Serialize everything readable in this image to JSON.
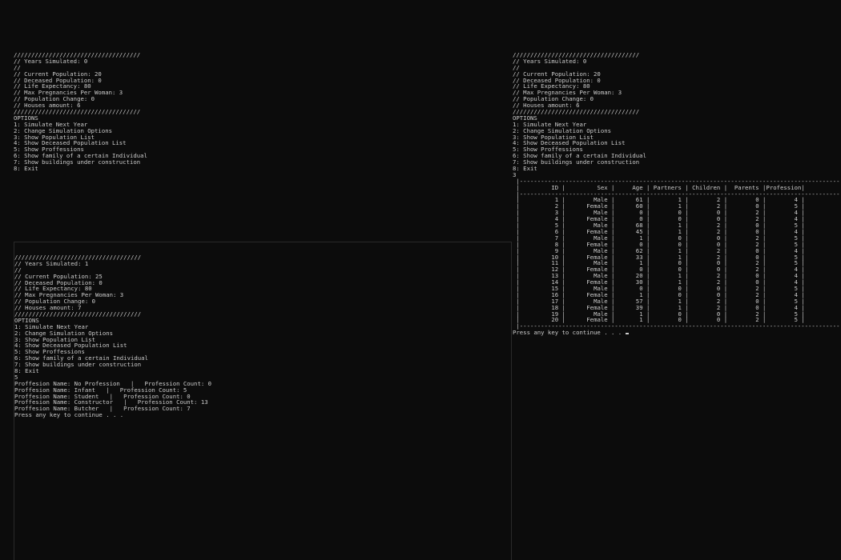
{
  "consoles": [
    {
      "id": "console-1",
      "lines": [
        "////////////////////////////////////",
        "// Years Simulated: 0",
        "//",
        "// Current Population: 20",
        "// Deceased Population: 0",
        "// Life Expectancy: 80",
        "// Max Pregnancies Per Woman: 3",
        "// Population Change: 0",
        "// Houses amount: 6",
        "////////////////////////////////////",
        "OPTIONS",
        "1: Simulate Next Year",
        "2: Change Simulation Options",
        "3: Show Population List",
        "4: Show Deceased Population List",
        "5: Show Proffessions",
        "6: Show family of a certain Individual",
        "7: Show buildings under construction",
        "8: Exit"
      ]
    },
    {
      "id": "console-2",
      "lines": [
        "////////////////////////////////////",
        "// Years Simulated: 1",
        "//",
        "// Current Population: 25",
        "// Deceased Population: 0",
        "// Life Expectancy: 80",
        "// Max Pregnancies Per Woman: 3",
        "// Population Change: 0",
        "// Houses amount: 7",
        "////////////////////////////////////",
        "OPTIONS",
        "1: Simulate Next Year",
        "2: Change Simulation Options",
        "3: Show Population List",
        "4: Show Deceased Population List",
        "5: Show Proffessions",
        "6: Show family of a certain Individual",
        "7: Show buildings under construction",
        "8: Exit",
        "5",
        "Proffesion Name: No Profession   |   Profession Count: 0",
        "Proffesion Name: Infant   |   Profession Count: 5",
        "Proffesion Name: Student   |   Profession Count: 0",
        "Proffesion Name: Constructor   |   Profession Count: 13",
        "Proffesion Name: Butcher   |   Profession Count: 7",
        "Press any key to continue . . ."
      ]
    },
    {
      "id": "console-3",
      "lines": [
        "////////////////////////////////////",
        "// Years Simulated: 0",
        "//",
        "// Current Population: 20",
        "// Deceased Population: 0",
        "// Life Expectancy: 80",
        "// Max Pregnancies Per Woman: 3",
        "// Population Change: 0",
        "// Houses amount: 6",
        "////////////////////////////////////",
        "OPTIONS",
        "1: Simulate Next Year",
        "2: Change Simulation Options",
        "3: Show Population List",
        "4: Show Deceased Population List",
        "5: Show Proffessions",
        "6: Show family of a certain Individual",
        "7: Show buildings under construction",
        "8: Exit",
        "3"
      ],
      "table": {
        "border": " |-------------------------------------------------------------------------------------------|",
        "headers": [
          "ID",
          "Sex",
          "Age",
          "Partners",
          "Children",
          "Parents",
          "Profession"
        ],
        "rows": [
          [
            "1",
            "Male",
            "61",
            "1",
            "2",
            "0",
            "4"
          ],
          [
            "2",
            "Female",
            "60",
            "1",
            "2",
            "0",
            "5"
          ],
          [
            "3",
            "Male",
            "0",
            "0",
            "0",
            "2",
            "4"
          ],
          [
            "4",
            "Female",
            "0",
            "0",
            "0",
            "2",
            "4"
          ],
          [
            "5",
            "Male",
            "68",
            "1",
            "2",
            "0",
            "5"
          ],
          [
            "6",
            "Female",
            "45",
            "1",
            "2",
            "0",
            "4"
          ],
          [
            "7",
            "Male",
            "1",
            "0",
            "0",
            "2",
            "5"
          ],
          [
            "8",
            "Female",
            "0",
            "0",
            "0",
            "2",
            "5"
          ],
          [
            "9",
            "Male",
            "62",
            "1",
            "2",
            "0",
            "4"
          ],
          [
            "10",
            "Female",
            "33",
            "1",
            "2",
            "0",
            "5"
          ],
          [
            "11",
            "Male",
            "1",
            "0",
            "0",
            "2",
            "5"
          ],
          [
            "12",
            "Female",
            "0",
            "0",
            "0",
            "2",
            "4"
          ],
          [
            "13",
            "Male",
            "20",
            "1",
            "2",
            "0",
            "4"
          ],
          [
            "14",
            "Female",
            "30",
            "1",
            "2",
            "0",
            "4"
          ],
          [
            "15",
            "Male",
            "0",
            "0",
            "0",
            "2",
            "5"
          ],
          [
            "16",
            "Female",
            "1",
            "0",
            "0",
            "2",
            "4"
          ],
          [
            "17",
            "Male",
            "57",
            "1",
            "2",
            "0",
            "5"
          ],
          [
            "18",
            "Female",
            "39",
            "1",
            "2",
            "0",
            "4"
          ],
          [
            "19",
            "Male",
            "1",
            "0",
            "0",
            "2",
            "5"
          ],
          [
            "20",
            "Female",
            "1",
            "0",
            "0",
            "2",
            "5"
          ]
        ]
      },
      "footer": "Press any key to continue . . ."
    }
  ]
}
